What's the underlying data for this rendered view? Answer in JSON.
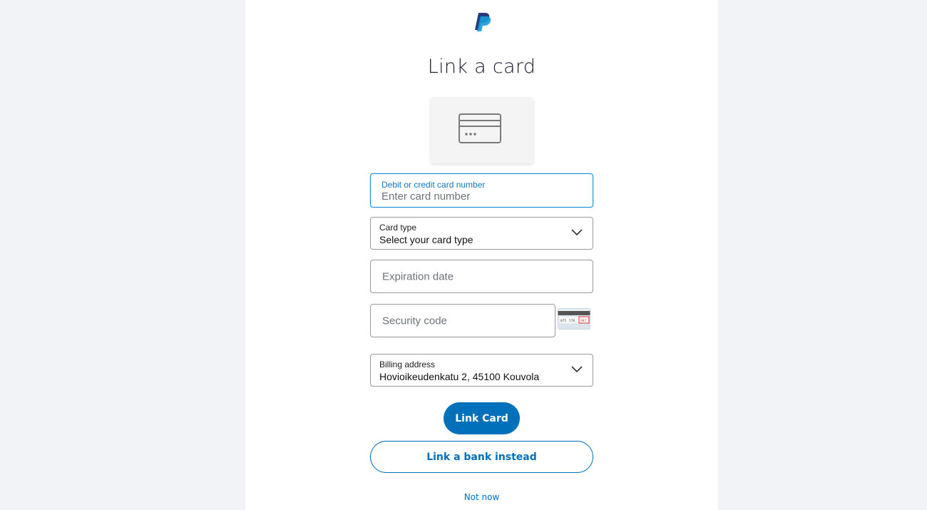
{
  "brand": {
    "logo_icon": "paypal-logo-icon",
    "accent_color": "#0070ba",
    "logo_colors": [
      "#253b80",
      "#179bd7"
    ]
  },
  "page": {
    "title": "Link a card",
    "card_icon": "credit-card-icon"
  },
  "form": {
    "card_number": {
      "label": "Debit or credit card number",
      "placeholder": "Enter card number",
      "value": ""
    },
    "card_type": {
      "label": "Card type",
      "value": "Select your card type",
      "icon": "chevron-down-icon"
    },
    "expiration": {
      "placeholder": "Expiration date"
    },
    "security_code": {
      "placeholder": "Security code",
      "cvv_icon": "card-back-cvv-icon",
      "cvv_illustration_text": [
        "075",
        "578",
        "987"
      ]
    },
    "billing_address": {
      "label": "Billing address",
      "value": "Hovioikeudenkatu 2, 45100 Kouvola",
      "icon": "chevron-down-icon"
    }
  },
  "actions": {
    "primary_label": "Link Card",
    "secondary_label": "Link a bank instead",
    "tertiary_label": "Not now"
  }
}
